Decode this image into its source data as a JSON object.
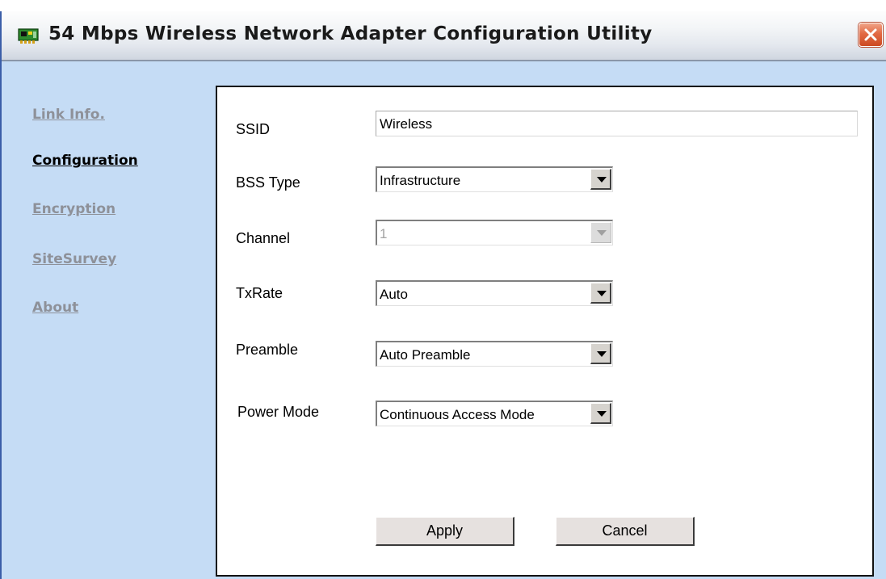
{
  "window": {
    "title": "54 Mbps Wireless Network Adapter Configuration Utility",
    "icon": "network-adapter-icon",
    "close_icon": "close-icon"
  },
  "nav": {
    "items": [
      {
        "label": "Link Info.",
        "active": false
      },
      {
        "label": "Configuration",
        "active": true
      },
      {
        "label": "Encryption",
        "active": false
      },
      {
        "label": "SiteSurvey",
        "active": false
      },
      {
        "label": "About",
        "active": false
      }
    ]
  },
  "form": {
    "ssid": {
      "label": "SSID",
      "value": "Wireless"
    },
    "bss_type": {
      "label": "BSS Type",
      "value": "Infrastructure"
    },
    "channel": {
      "label": "Channel",
      "value": "1",
      "disabled": true
    },
    "txrate": {
      "label": "TxRate",
      "value": "Auto"
    },
    "preamble": {
      "label": "Preamble",
      "value": "Auto Preamble"
    },
    "power_mode": {
      "label": "Power Mode",
      "value": "Continuous Access Mode"
    }
  },
  "buttons": {
    "apply": "Apply",
    "cancel": "Cancel"
  },
  "colors": {
    "window_bg": "#c5dcf5",
    "close_button": "#e26a44",
    "nav_inactive": "#8e9199"
  }
}
